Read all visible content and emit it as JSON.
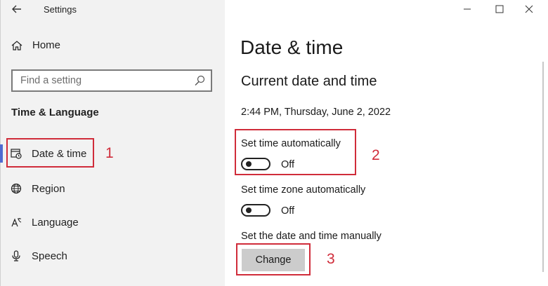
{
  "window": {
    "title": "Settings",
    "controls": {
      "minimize": "—",
      "maximize": "☐",
      "close": "✕"
    }
  },
  "sidebar": {
    "home_label": "Home",
    "search": {
      "placeholder": "Find a setting"
    },
    "section_heading": "Time & Language",
    "items": [
      {
        "label": "Date & time",
        "icon": "calendar-clock-icon",
        "selected": true
      },
      {
        "label": "Region",
        "icon": "globe-icon"
      },
      {
        "label": "Language",
        "icon": "language-icon"
      },
      {
        "label": "Speech",
        "icon": "microphone-icon"
      }
    ]
  },
  "main": {
    "page_title": "Date & time",
    "section_title": "Current date and time",
    "current_datetime": "2:44 PM, Thursday, June 2, 2022",
    "set_time_auto": {
      "label": "Set time automatically",
      "state": "Off"
    },
    "set_tz_auto": {
      "label": "Set time zone automatically",
      "state": "Off"
    },
    "manual": {
      "label": "Set the date and time manually",
      "button_label": "Change"
    }
  },
  "annotations": {
    "marker1": "1",
    "marker2": "2",
    "marker3": "3",
    "color": "#d02c3a"
  },
  "colors": {
    "accent": "#4f6bd1",
    "sidebar_bg": "#f2f2f2",
    "button_bg": "#cccccc"
  }
}
